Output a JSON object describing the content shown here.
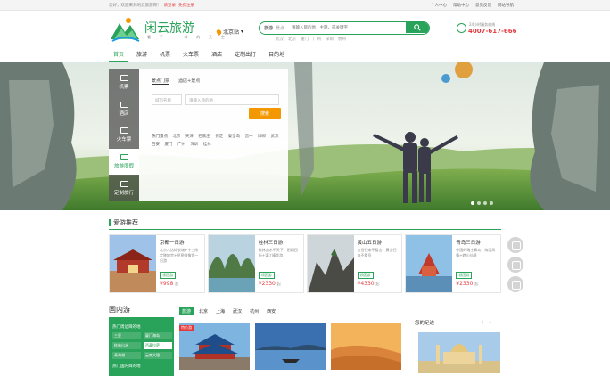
{
  "topbar": {
    "welcome": "您好，欢迎来到闲云旅游网！",
    "login": "请登录",
    "register": "免费注册",
    "links": [
      "个人中心",
      "帮助中心",
      "意见反馈",
      "网站导航"
    ]
  },
  "header": {
    "brand": "闲云旅游",
    "slogan": "看 · 不 · 一 · 样 · 的 · 天 · 空",
    "city": "北京站",
    "search": {
      "category": "旅游",
      "category2": "景点",
      "placeholder": "请输入目的地，主题，或关键字"
    },
    "hot_searches": [
      "武汉",
      "北京",
      "厦门",
      "广州",
      "深圳",
      "杭州"
    ],
    "phone_label": "24小时服务热线",
    "phone": "4007-617-666"
  },
  "nav": [
    "首页",
    "旅游",
    "机票",
    "火车票",
    "酒店",
    "定制出行",
    "目的地"
  ],
  "booking": {
    "sidebar": [
      "机票",
      "酒店",
      "火车票",
      "旅游度假",
      "定制旅行"
    ],
    "tabs": [
      "景点门票",
      "酒店+景点"
    ],
    "input_from": "城市名称",
    "input_keyword": "请输入目的地",
    "search_button": "搜索",
    "hot_label": "热门景点",
    "hot_cities": [
      "北京",
      "天津",
      "石家庄",
      "保定",
      "秦皇岛",
      "晋中",
      "邯郸",
      "武汉",
      "西安",
      "厦门",
      "广州",
      "深圳",
      "桂林"
    ]
  },
  "section_title": "爱游推荐",
  "cards": [
    {
      "title": "京都一日游",
      "desc": "北京八达岭长城+十三陵定陵地宫+明皇蜡像馆一日游",
      "tag": "领团游",
      "price": "¥998",
      "unit": "起"
    },
    {
      "title": "桂林三日游",
      "desc": "桂林山水甲天下，阳朔西街+漓江精华游",
      "tag": "领团游",
      "price": "¥2330",
      "unit": "起"
    },
    {
      "title": "黄山五日游",
      "desc": "五岳归来不看山，黄山归来不看岳",
      "tag": "领团游",
      "price": "¥4330",
      "unit": "起"
    },
    {
      "title": "青岛三日游",
      "desc": "中国的瑞士青岛，海滨风情+崂山仙境",
      "tag": "领团游",
      "price": "¥2330",
      "unit": "起"
    }
  ],
  "domestic": {
    "title": "国内游",
    "tabs": [
      "旅游",
      "北京",
      "上海",
      "武汉",
      "杭州",
      "西安"
    ],
    "side_head1": "热门周边目的地",
    "side_row1": [
      "三亚",
      "厦门海岛"
    ],
    "side_row2": [
      "桂林山水",
      "西藏拉萨"
    ],
    "side_row3": [
      "青海湖",
      "云南大理"
    ],
    "side_head2": "热门国内目的地",
    "label": "特价游"
  },
  "visited": {
    "title": "您的足迹"
  }
}
